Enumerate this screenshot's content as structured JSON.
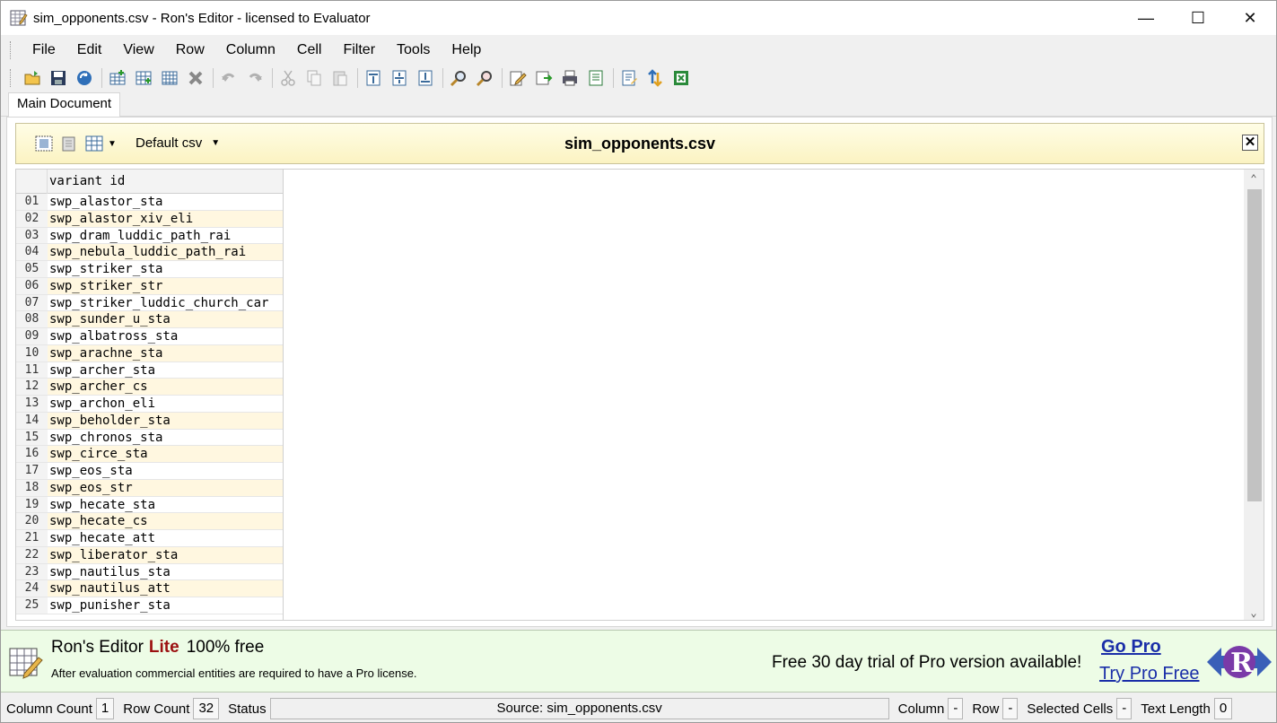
{
  "window": {
    "title": "sim_opponents.csv - Ron's Editor - licensed to Evaluator",
    "minimize": "—",
    "maximize": "☐",
    "close": "✕"
  },
  "menu": [
    "File",
    "Edit",
    "View",
    "Row",
    "Column",
    "Cell",
    "Filter",
    "Tools",
    "Help"
  ],
  "tab": {
    "label": "Main Document"
  },
  "doc_header": {
    "profile": "Default csv",
    "title": "sim_opponents.csv",
    "close": "✕"
  },
  "grid": {
    "column_header": "variant id",
    "rows": [
      {
        "n": "01",
        "v": "swp_alastor_sta"
      },
      {
        "n": "02",
        "v": "swp_alastor_xiv_eli"
      },
      {
        "n": "03",
        "v": "swp_dram_luddic_path_rai"
      },
      {
        "n": "04",
        "v": "swp_nebula_luddic_path_rai"
      },
      {
        "n": "05",
        "v": "swp_striker_sta"
      },
      {
        "n": "06",
        "v": "swp_striker_str"
      },
      {
        "n": "07",
        "v": "swp_striker_luddic_church_car"
      },
      {
        "n": "08",
        "v": "swp_sunder_u_sta"
      },
      {
        "n": "09",
        "v": "swp_albatross_sta"
      },
      {
        "n": "10",
        "v": "swp_arachne_sta"
      },
      {
        "n": "11",
        "v": "swp_archer_sta"
      },
      {
        "n": "12",
        "v": "swp_archer_cs"
      },
      {
        "n": "13",
        "v": "swp_archon_eli"
      },
      {
        "n": "14",
        "v": "swp_beholder_sta"
      },
      {
        "n": "15",
        "v": "swp_chronos_sta"
      },
      {
        "n": "16",
        "v": "swp_circe_sta"
      },
      {
        "n": "17",
        "v": "swp_eos_sta"
      },
      {
        "n": "18",
        "v": "swp_eos_str"
      },
      {
        "n": "19",
        "v": "swp_hecate_sta"
      },
      {
        "n": "20",
        "v": "swp_hecate_cs"
      },
      {
        "n": "21",
        "v": "swp_hecate_att"
      },
      {
        "n": "22",
        "v": "swp_liberator_sta"
      },
      {
        "n": "23",
        "v": "swp_nautilus_sta"
      },
      {
        "n": "24",
        "v": "swp_nautilus_att"
      },
      {
        "n": "25",
        "v": "swp_punisher_sta"
      }
    ]
  },
  "banner": {
    "editor_name": "Ron's Editor",
    "edition": "Lite",
    "price": "100% free",
    "notice": "After evaluation commercial entities are required to have a Pro license.",
    "trial": "Free 30 day trial of Pro version available!",
    "go_pro": "Go Pro",
    "try_pro": "Try Pro Free"
  },
  "status": {
    "column_count_label": "Column Count",
    "column_count": "1",
    "row_count_label": "Row Count",
    "row_count": "32",
    "status_label": "Status",
    "source": "Source: sim_opponents.csv",
    "column_label": "Column",
    "column_val": "-",
    "row_label": "Row",
    "row_val": "-",
    "selected_label": "Selected Cells",
    "selected_val": "-",
    "text_length_label": "Text Length",
    "text_length_val": "0"
  },
  "colors": {
    "row_alt": "#fff7e0",
    "header_yellow": "#fbf3c2",
    "banner_green": "#edfce6",
    "link_blue": "#1a2ea8",
    "lite_red": "#9b1010"
  }
}
